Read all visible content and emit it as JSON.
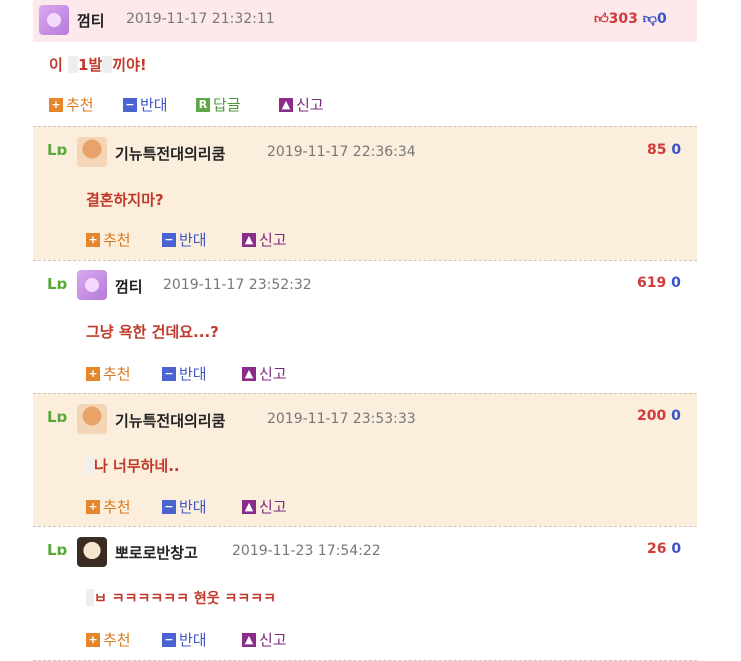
{
  "post": {
    "nickname": "껌티",
    "datetime": "2019-11-17 21:32:11",
    "up_icon": "thumbs-up-icon",
    "up_count": "303",
    "down_icon": "thumbs-down-icon",
    "down_count": "0",
    "text_a": "이",
    "text_b": "1발",
    "text_c": "끼야!",
    "actions": {
      "recommend": "추천",
      "oppose": "반대",
      "reply": "답글",
      "report": "신고"
    }
  },
  "comments": [
    {
      "nickname": "기뉴특전대의리쿰",
      "datetime": "2019-11-17 22:36:34",
      "up": "85",
      "down": "0",
      "text": "결혼하지마?"
    },
    {
      "nickname": "껌티",
      "datetime": "2019-11-17 23:52:32",
      "up": "619",
      "down": "0",
      "text": "그냥 욕한 건데요...?"
    },
    {
      "nickname": "기뉴특전대의리쿰",
      "datetime": "2019-11-17 23:53:33",
      "up": "200",
      "down": "0",
      "text": "나 너무하네.."
    },
    {
      "nickname": "뽀로로반창고",
      "datetime": "2019-11-23 17:54:22",
      "up": "26",
      "down": "0",
      "text": "ㅂ ㅋㅋㅋㅋㅋㅋ 현웃 ㅋㅋㅋㅋ"
    }
  ],
  "comment_actions": {
    "recommend": "추천",
    "oppose": "반대",
    "report": "신고"
  },
  "reply_marker": "Lɒ",
  "colors": {
    "post_header_bg": "#fde8ec",
    "comment_tan_bg": "#fbeedd",
    "up": "#d03a3a",
    "down": "#3a52c8"
  }
}
